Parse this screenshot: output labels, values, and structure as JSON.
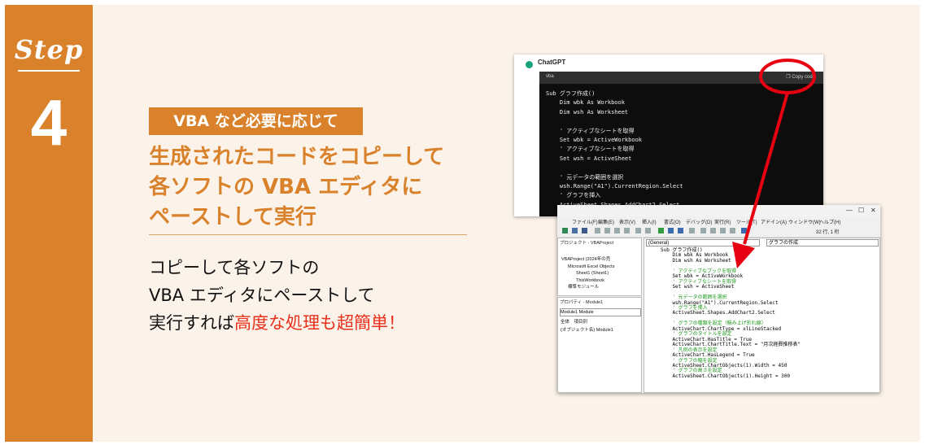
{
  "step": {
    "label": "Step",
    "number": "4"
  },
  "tag": "VBA など必要に応じて",
  "heading": [
    "生成されたコードをコピーして",
    "各ソフトの VBA エディタに",
    "ペーストして実行"
  ],
  "body": {
    "line1": "コピーして各ソフトの",
    "line2": "VBA エディタにペーストして",
    "line3_prefix": "実行すれば",
    "line3_highlight": "高度な処理も超簡単！",
    "highlight_color": "#e8301c"
  },
  "chatgpt": {
    "title": "ChatGPT",
    "lang": "vba",
    "copy_label": "Copy code",
    "lines": [
      "Sub グラフ作成()",
      "    Dim wbk As Workbook",
      "    Dim wsh As Worksheet",
      "",
      "    ' アクティブなシートを取得",
      "    Set wbk = ActiveWorkbook",
      "    ' アクティブなシートを取得",
      "    Set wsh = ActiveSheet",
      "",
      "    ' 元データの範囲を選択",
      "    wsh.Range(\"A1\").CurrentRegion.Select",
      "    ' グラフを挿入",
      "    ActiveSheet.Shapes.AddChart2.Select"
    ]
  },
  "vbe": {
    "menu": [
      "ファイル(F)",
      "編集(E)",
      "表示(V)",
      "挿入(I)",
      "書式(O)",
      "デバッグ(D)",
      "実行(R)",
      "ツール(T)",
      "アドイン(A)",
      "ウィンドウ(W)",
      "ヘルプ(H)"
    ],
    "position": "32 行, 1 桁",
    "project_title": "プロジェクト - VBAProject",
    "project_tree": [
      "VBAProject (2024年の売",
      "Microsoft Excel Objects",
      "Sheet1 (Sheet1)",
      "ThisWorkbook",
      "標準モジュール"
    ],
    "properties_title": "プロパティ - Module1",
    "properties_combo": "Module1 Module",
    "properties_tabs": [
      "全体",
      "項目別"
    ],
    "properties_row": [
      "(オブジェクト名)",
      "Module1"
    ],
    "combo_general": "(General)",
    "combo_proc": "グラフの作成",
    "code": [
      {
        "t": "Sub グラフ作成()",
        "c": false
      },
      {
        "t": "    Dim wbk As Workbook",
        "c": false
      },
      {
        "t": "    Dim wsh As Worksheet",
        "c": false
      },
      {
        "t": "",
        "c": false
      },
      {
        "t": "    ' アクティブなブックを取得",
        "c": true
      },
      {
        "t": "    Set wbk = ActiveWorkbook",
        "c": false
      },
      {
        "t": "    ' アクティブなシートを取得",
        "c": true
      },
      {
        "t": "    Set wsh = ActiveSheet",
        "c": false
      },
      {
        "t": "",
        "c": false
      },
      {
        "t": "    ' 元データの範囲を選択",
        "c": true
      },
      {
        "t": "    wsh.Range(\"A1\").CurrentRegion.Select",
        "c": false
      },
      {
        "t": "    ' グラフを挿入",
        "c": true
      },
      {
        "t": "    ActiveSheet.Shapes.AddChart2.Select",
        "c": false
      },
      {
        "t": "",
        "c": false
      },
      {
        "t": "    ' グラフの種類を設定（積み上げ折れ線）",
        "c": true
      },
      {
        "t": "    ActiveChart.ChartType = xlLineStacked",
        "c": false
      },
      {
        "t": "    ' グラフのタイトルを設定",
        "c": true
      },
      {
        "t": "    ActiveChart.HasTitle = True",
        "c": false
      },
      {
        "t": "    ActiveChart.ChartTitle.Text = \"月次経費推移表\"",
        "c": false
      },
      {
        "t": "    ' 凡例の表示を設定",
        "c": true
      },
      {
        "t": "    ActiveChart.HasLegend = True",
        "c": false
      },
      {
        "t": "    ' グラフの幅を設定",
        "c": true
      },
      {
        "t": "    ActiveSheet.ChartObjects(1).Width = 450",
        "c": false
      },
      {
        "t": "    ' グラフの高さを設定",
        "c": true
      },
      {
        "t": "    ActiveSheet.ChartObjects(1).Height = 300",
        "c": false
      }
    ]
  },
  "colors": {
    "accent": "#d9822b",
    "background": "#fbf3e9",
    "annotation_red": "#e60012"
  }
}
